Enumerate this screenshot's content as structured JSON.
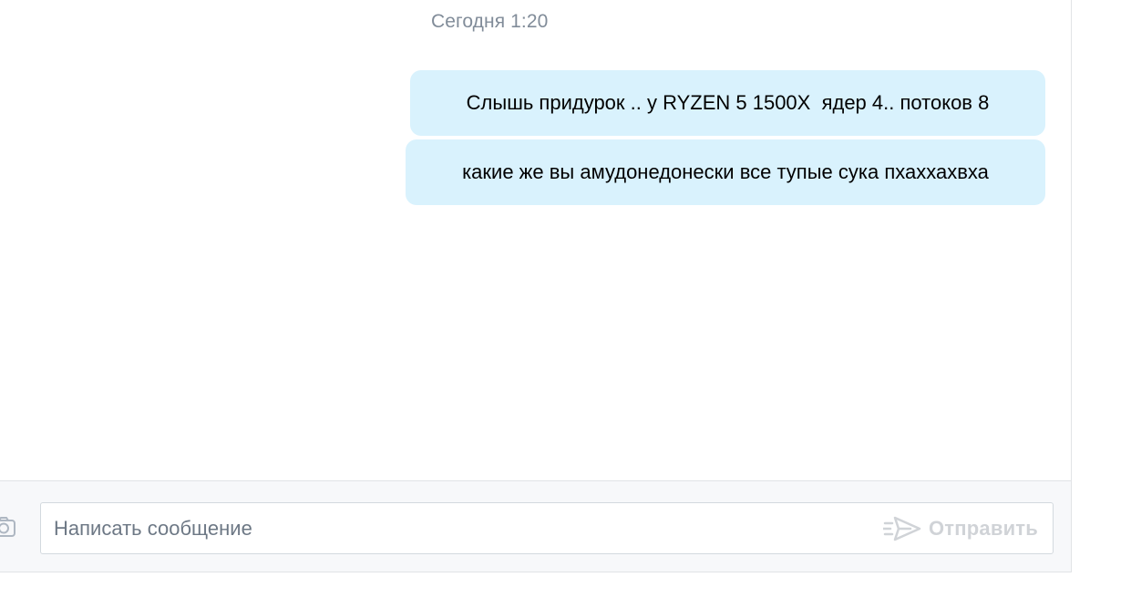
{
  "chat": {
    "timestamp": "Сегодня 1:20",
    "messages": [
      {
        "text": "Слышь придурок .. у RYZEN 5 1500X  ядер 4.. потоков 8",
        "direction": "outgoing"
      },
      {
        "text": "какие же вы амудонедонески все тупые сука пхаххахвха",
        "direction": "outgoing"
      }
    ]
  },
  "composer": {
    "placeholder": "Написать сообщение",
    "value": "",
    "send_label": "Отправить",
    "send_icon": "paper-plane-icon",
    "attach_icon": "camera-icon"
  },
  "colors": {
    "bubble": "#d9f2fd",
    "timestamp": "#818c99",
    "send_disabled": "#d0d3d7",
    "composer_bg": "#f7f8fa"
  }
}
